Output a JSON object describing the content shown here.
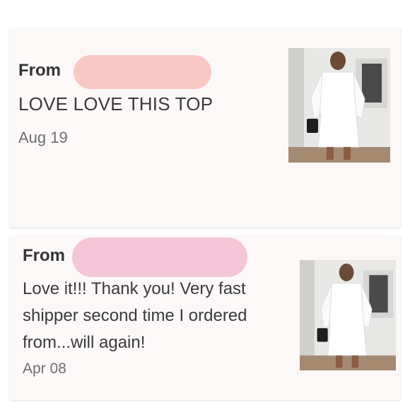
{
  "reviews": [
    {
      "from_label": "From",
      "message": "LOVE LOVE THIS TOP",
      "date": "Aug 19",
      "product_image": "white-shirt-dress-photo"
    },
    {
      "from_label": "From",
      "message": "Love it!!! Thank you! Very fast shipper second time I ordered from...will again!",
      "date": "Apr 08",
      "product_image": "white-shirt-dress-photo"
    }
  ],
  "colors": {
    "card_bg": "#fcf8f8",
    "redaction_1": "#f8c9c4",
    "redaction_2": "#f4c6d8",
    "text_dark": "#333333",
    "text_muted": "#6e6e6e"
  }
}
